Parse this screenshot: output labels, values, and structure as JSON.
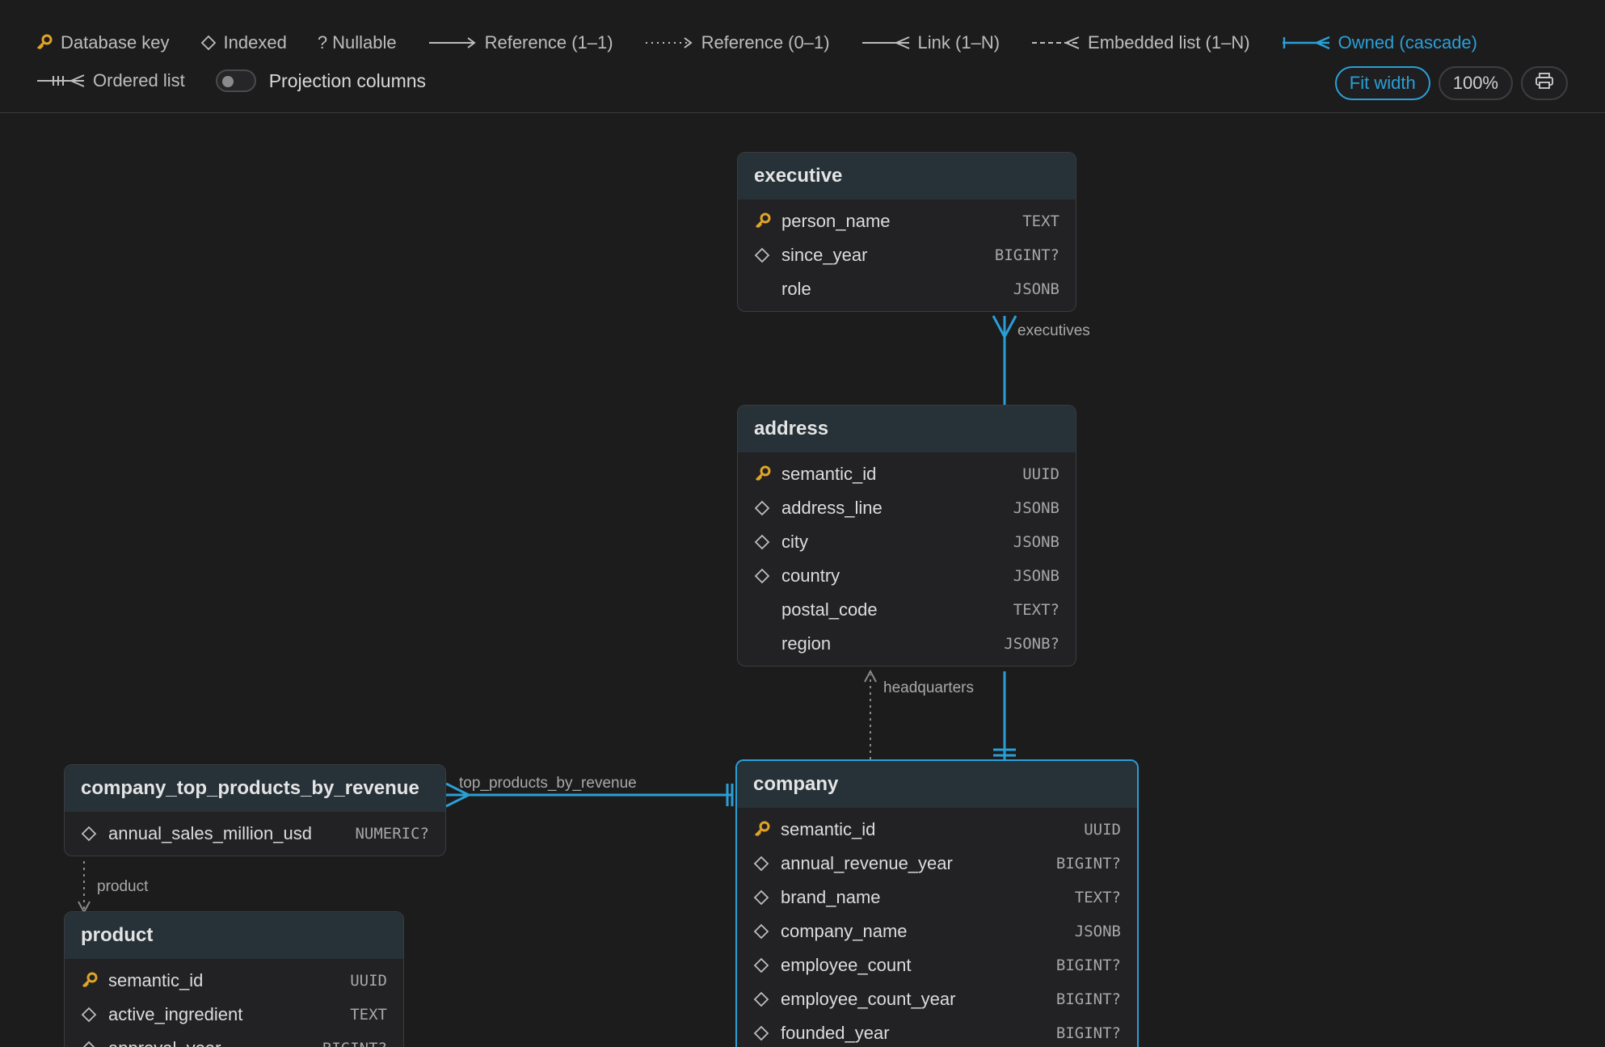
{
  "legend": {
    "items": [
      {
        "glyph": "key-icon",
        "label": "Database key"
      },
      {
        "glyph": "diamond-icon",
        "label": "Indexed"
      },
      {
        "glyph": "?",
        "label": "Nullable"
      },
      {
        "glyph": "reference-arrow-icon",
        "label": "Reference (1–1)"
      },
      {
        "glyph": "dotted-arrow-icon",
        "label": "Reference (0–1)"
      },
      {
        "glyph": "crowfoot-icon",
        "label": "Link (1–N)"
      },
      {
        "glyph": "dashed-crowfoot-icon",
        "label": "Embedded list (1–N)"
      },
      {
        "glyph": "owned-crowfoot-icon",
        "label": "Owned (cascade)"
      },
      {
        "glyph": "ordered-crowfoot-icon",
        "label": "Ordered list"
      }
    ],
    "projection_label": "Projection columns",
    "projection_enabled": false
  },
  "toolbar": {
    "fit_width": "Fit width",
    "zoom": "100%",
    "print_icon": "printer-icon"
  },
  "colors": {
    "accent": "#2a9fd6",
    "key": "#e0a526",
    "background": "#1c1c1d",
    "header": "#263138"
  },
  "entities": {
    "executive": {
      "name": "executive",
      "fields": [
        {
          "mark": "key",
          "name": "person_name",
          "type": "TEXT"
        },
        {
          "mark": "index",
          "name": "since_year",
          "type": "BIGINT?"
        },
        {
          "mark": "none",
          "name": "role",
          "type": "JSONB"
        }
      ]
    },
    "address": {
      "name": "address",
      "fields": [
        {
          "mark": "key",
          "name": "semantic_id",
          "type": "UUID"
        },
        {
          "mark": "index",
          "name": "address_line",
          "type": "JSONB"
        },
        {
          "mark": "index",
          "name": "city",
          "type": "JSONB"
        },
        {
          "mark": "index",
          "name": "country",
          "type": "JSONB"
        },
        {
          "mark": "none",
          "name": "postal_code",
          "type": "TEXT?"
        },
        {
          "mark": "none",
          "name": "region",
          "type": "JSONB?"
        }
      ]
    },
    "company": {
      "name": "company",
      "fields": [
        {
          "mark": "key",
          "name": "semantic_id",
          "type": "UUID"
        },
        {
          "mark": "index",
          "name": "annual_revenue_year",
          "type": "BIGINT?"
        },
        {
          "mark": "index",
          "name": "brand_name",
          "type": "TEXT?"
        },
        {
          "mark": "index",
          "name": "company_name",
          "type": "JSONB"
        },
        {
          "mark": "index",
          "name": "employee_count",
          "type": "BIGINT?"
        },
        {
          "mark": "index",
          "name": "employee_count_year",
          "type": "BIGINT?"
        },
        {
          "mark": "index",
          "name": "founded_year",
          "type": "BIGINT?"
        }
      ]
    },
    "company_top_products_by_revenue": {
      "name": "company_top_products_by_revenue",
      "fields": [
        {
          "mark": "index",
          "name": "annual_sales_million_usd",
          "type": "NUMERIC?"
        }
      ]
    },
    "product": {
      "name": "product",
      "fields": [
        {
          "mark": "key",
          "name": "semantic_id",
          "type": "UUID"
        },
        {
          "mark": "index",
          "name": "active_ingredient",
          "type": "TEXT"
        },
        {
          "mark": "index",
          "name": "approval_year",
          "type": "BIGINT?"
        }
      ]
    }
  },
  "relations": [
    {
      "label": "executives",
      "from": "address",
      "to": "executive",
      "kind": "owned"
    },
    {
      "label": "headquarters",
      "from": "company",
      "to": "address",
      "kind": "reference-optional"
    },
    {
      "label": "",
      "from": "company",
      "to": "address",
      "kind": "owned"
    },
    {
      "label": "top_products_by_revenue",
      "from": "company",
      "to": "company_top_products_by_revenue",
      "kind": "owned"
    },
    {
      "label": "product",
      "from": "company_top_products_by_revenue",
      "to": "product",
      "kind": "reference-optional"
    }
  ]
}
